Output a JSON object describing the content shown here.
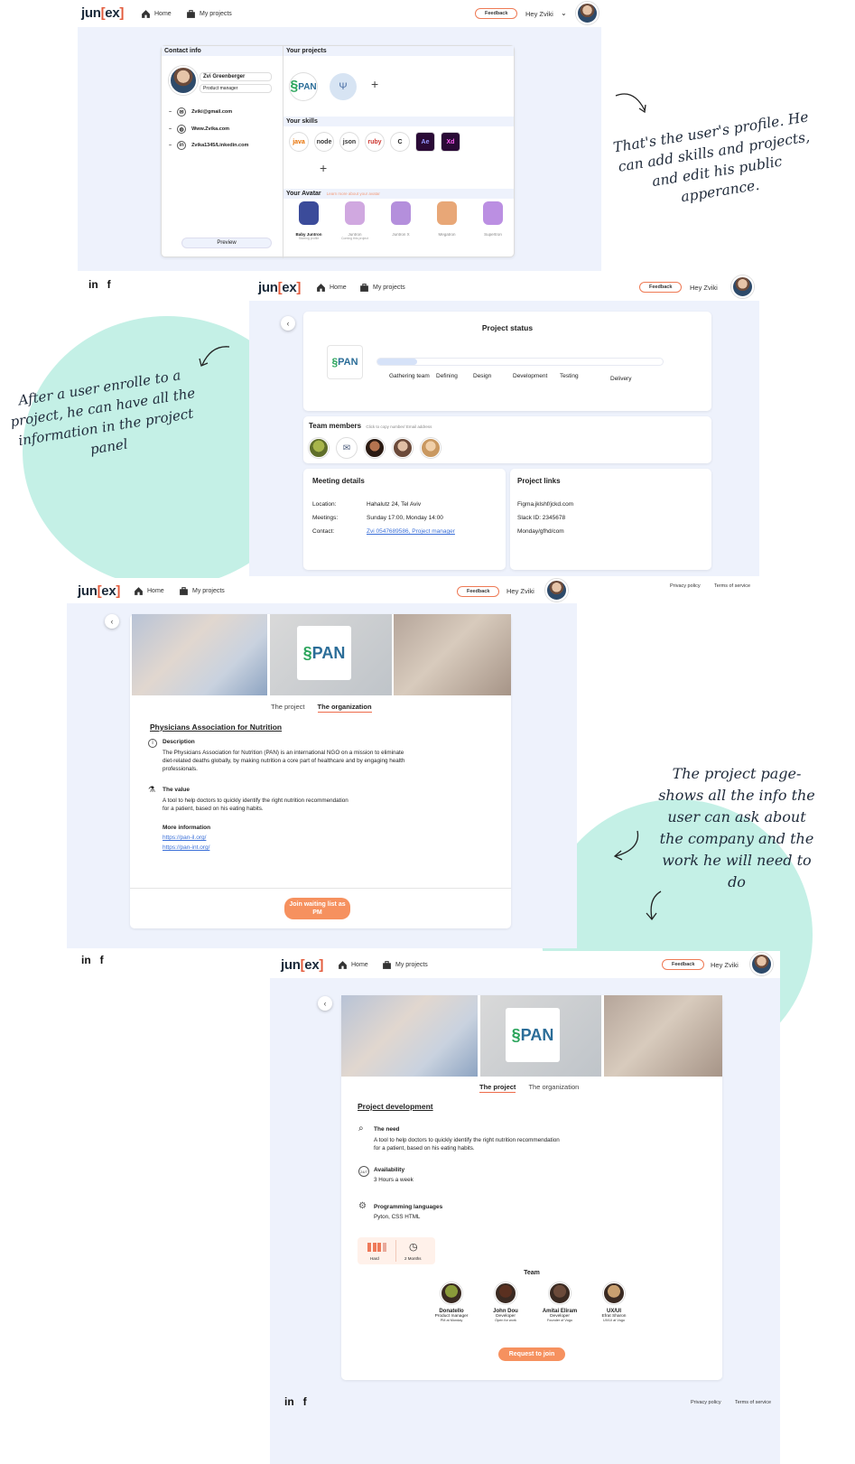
{
  "brand": {
    "logo_main": "jun",
    "logo_open": "[",
    "logo_mid": "ex",
    "logo_close": "]"
  },
  "nav": {
    "home": "Home",
    "projects": "My projects",
    "feedback": "Feedback",
    "greeting": "Hey Zviki"
  },
  "footer": {
    "linkedin": "in",
    "facebook": "f",
    "privacy": "Privacy policy",
    "terms": "Terms of service"
  },
  "annotations": {
    "profile": "That's the user's profile. He can add skills and projects, and edit his public apperance.",
    "panel": "After a user enrolle to a project, he can have all the information in the project panel",
    "project_page": "The project page- shows all the info the user can ask about the company and the work he will need to do"
  },
  "profile": {
    "contact_title": "Contact info",
    "name": "Zvi Greenberger",
    "role": "Product manager",
    "email": "Zviki@gmail.com",
    "website": "Www.Zvika.com",
    "linkedin": "Zvika1345/Linkedin.com",
    "preview": "Preview",
    "projects_title": "Your projects",
    "skills_title": "Your skills",
    "avatar_title": "Your Avatar",
    "avatar_hint": "Learn more about your avatar",
    "pan_logo": "PAN",
    "add": "+",
    "skills": [
      {
        "name": "java",
        "color": "#e76f00"
      },
      {
        "name": "node",
        "color": "#333333"
      },
      {
        "name": "json",
        "color": "#333333"
      },
      {
        "name": "ruby",
        "color": "#cc342d"
      },
      {
        "name": "C",
        "color": "#222222"
      },
      {
        "name": "Ae",
        "color": "#9999ff"
      },
      {
        "name": "Xd",
        "color": "#ff61f6"
      }
    ],
    "avatars": [
      {
        "name": "Baby Juntron",
        "sub": "Starting profile",
        "color": "#3b4b9a"
      },
      {
        "name": "Juntron",
        "sub": "Coming this project",
        "color": "#c08bd6"
      },
      {
        "name": "Juntron X",
        "sub": "",
        "color": "#9b6ad0"
      },
      {
        "name": "Megatron",
        "sub": "",
        "color": "#e08a4a"
      },
      {
        "name": "Supertron",
        "sub": "",
        "color": "#a46ad8"
      }
    ]
  },
  "panel": {
    "status_title": "Project status",
    "stages": [
      "Gathering team",
      "Defining",
      "Design",
      "Development",
      "Testing",
      "Delivery"
    ],
    "progress": 0.14,
    "members_title": "Team members",
    "members_hint": "Click to copy number/ Email address",
    "meeting_title": "Meeting details",
    "location_label": "Location:",
    "location": "Hahalutz 24, Tel Aviv",
    "meetings_label": "Meetings:",
    "meetings": "Sunday 17:00, Monday 14:00",
    "contact_label": "Contact:",
    "contact": "Zvi 0547689586, Project manager",
    "links_title": "Project links",
    "links": [
      "Figma.jklshf/jckd.com",
      "Slack ID: 2345678",
      "Monday/gfhd/com"
    ]
  },
  "org_page": {
    "tab_project": "The project",
    "tab_org": "The organization",
    "title": "Physicians Association for Nutrition",
    "desc_title": "Description",
    "desc": "The Physicians Association for Nutrition (PAN) is an international NGO on a mission to eliminate diet-related deaths globally, by making nutrition a core part of healthcare and by engaging health professionals.",
    "value_title": "The value",
    "value": "A tool to help doctors to quickly identify the right nutrition recommendation for a patient, based on his eating habits.",
    "more_title": "More information",
    "links": [
      "https://pan-il.org/",
      "https://pan-int.org/"
    ],
    "join": "Join waiting list as PM"
  },
  "project_page": {
    "title": "Project development",
    "need_title": "The need",
    "need": "A tool to help doctors to quickly identify the right nutrition recommendation for a patient, based on his eating habits.",
    "avail_title": "Availability",
    "avail": "3 Hours a week",
    "lang_title": "Programming languages",
    "lang": "Pyton, CSS HTML",
    "difficulty": "Hard",
    "duration": "2 Months",
    "team_title": "Team",
    "team": [
      {
        "name": "Donatello",
        "role": "Product manager",
        "sub": "PM at Monday",
        "color": "#8a9a3a"
      },
      {
        "name": "John Dou",
        "role": "Developer",
        "sub": "Open for work",
        "color": "#5a3020"
      },
      {
        "name": "Amitai Eliram",
        "role": "Developer",
        "sub": "Founder of Vogo",
        "color": "#6b4a3a"
      },
      {
        "name": "UX/UI",
        "role": "Efrat Sharon",
        "sub": "UX/UI at Vogo",
        "color": "#c9a070"
      }
    ],
    "request": "Request to join"
  }
}
